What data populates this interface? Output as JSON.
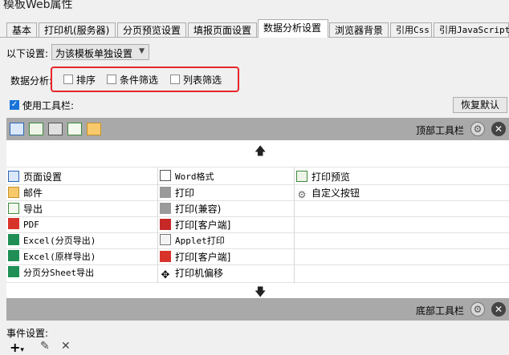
{
  "window": {
    "title": "模板Web属性"
  },
  "tabs": [
    {
      "label": "基本"
    },
    {
      "label": "打印机(服务器)"
    },
    {
      "label": "分页预览设置"
    },
    {
      "label": "填报页面设置"
    },
    {
      "label": "数据分析设置"
    },
    {
      "label": "浏览器背景"
    },
    {
      "label": "引用Css"
    },
    {
      "label": "引用JavaScript"
    }
  ],
  "settings": {
    "label": "以下设置:",
    "select_value": "为该模板单独设置"
  },
  "data_analysis": {
    "label": "数据分析:",
    "options": [
      "排序",
      "条件筛选",
      "列表筛选"
    ]
  },
  "toolbar_option": {
    "label": "使用工具栏:",
    "checked": true,
    "restore_button": "恢复默认"
  },
  "top_toolbar": {
    "label": "顶部工具栏",
    "icons": [
      "page-setup-icon",
      "print-preview-icon",
      "print-icon",
      "export-icon",
      "mail-icon"
    ]
  },
  "bottom_toolbar": {
    "label": "底部工具栏"
  },
  "buttons": {
    "col1": [
      "页面设置",
      "邮件",
      "导出",
      "PDF",
      "Excel(分页导出)",
      "Excel(原样导出)",
      "分页分Sheet导出"
    ],
    "col2": [
      "Word格式",
      "打印",
      "打印(兼容)",
      "打印[客户端]",
      "Applet打印",
      "打印[客户端]",
      "打印机偏移"
    ],
    "col3": [
      "打印预览",
      "自定义按钮"
    ]
  },
  "events": {
    "label": "事件设置:"
  },
  "colors": {
    "accent": "#1a73d9",
    "highlight_border": "#e8262a",
    "toolbar_bg": "#a9a9a9"
  }
}
